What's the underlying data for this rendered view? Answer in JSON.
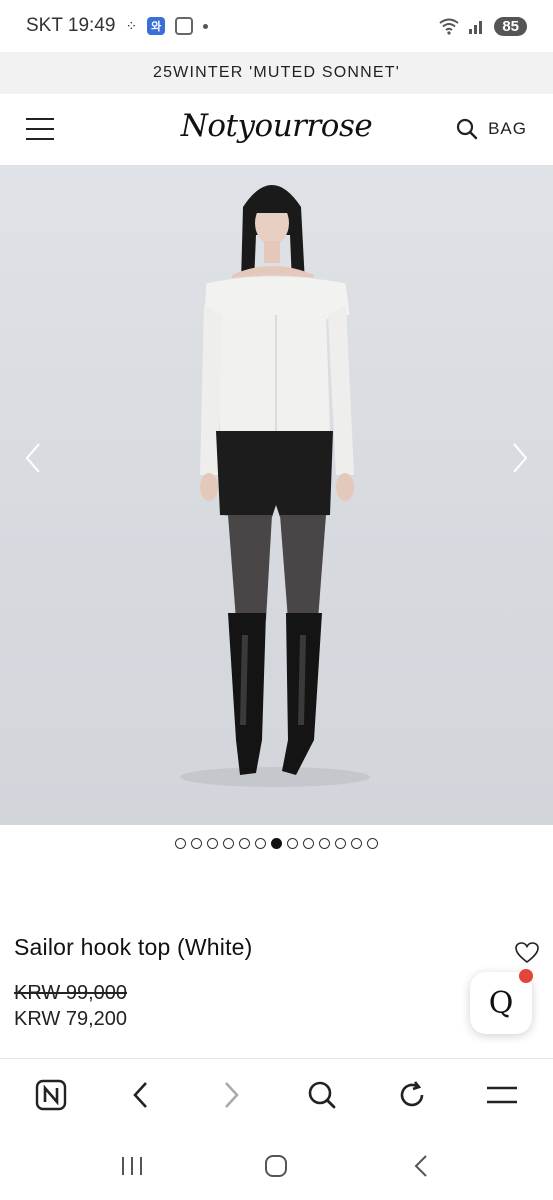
{
  "status_bar": {
    "carrier_time": "SKT 19:49",
    "blue_badge": "와",
    "battery": "85"
  },
  "announcement": "25WINTER 'MUTED SONNET'",
  "header": {
    "logo": "Notyourrose",
    "bag_label": "BAG"
  },
  "gallery": {
    "total_images": 13,
    "active_index": 6
  },
  "product": {
    "title": "Sailor hook top (White)",
    "original_price": "KRW 99,000",
    "sale_price": "KRW 79,200"
  },
  "chat_button": {
    "label": "Q"
  },
  "colors": {
    "badge": "#e3453a",
    "accent_blue": "#3a6fd8"
  },
  "icons": {
    "browser_bar": [
      "naver-icon",
      "back-icon",
      "forward-icon",
      "search-icon",
      "refresh-icon",
      "menu-icon"
    ],
    "system_nav": [
      "recents-icon",
      "home-icon",
      "back-icon"
    ]
  }
}
